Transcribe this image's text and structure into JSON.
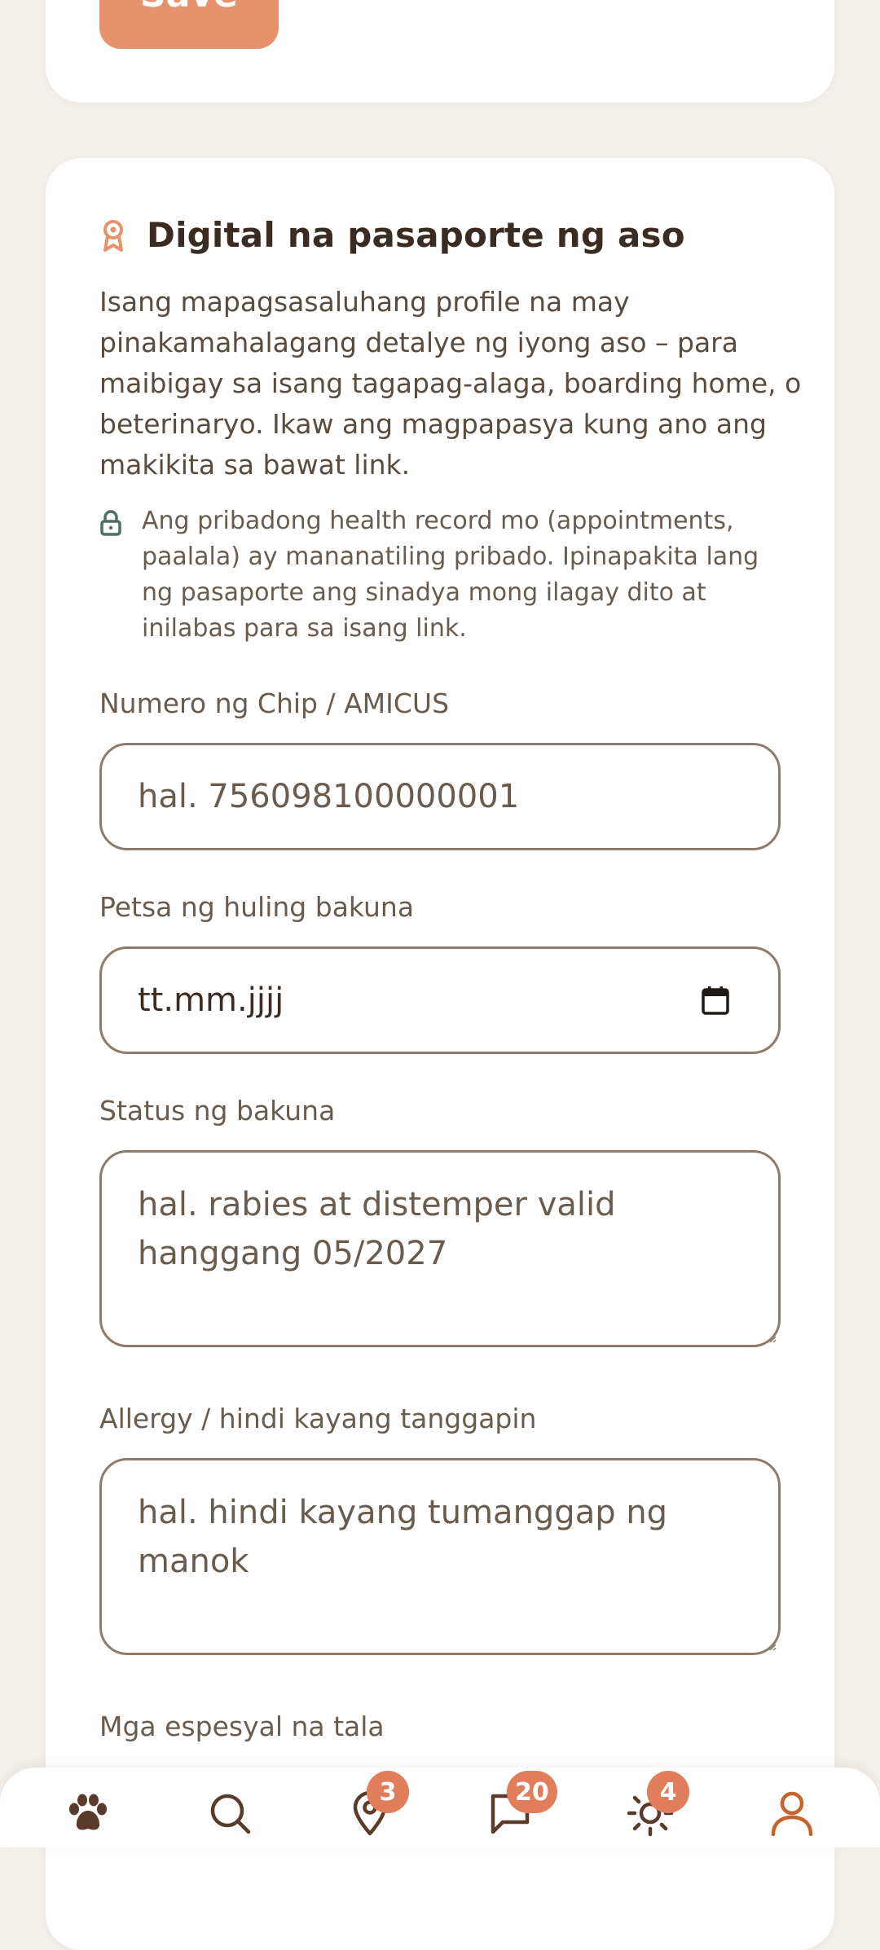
{
  "top_card": {
    "save_label": "Save"
  },
  "passport": {
    "title": "Digital na pasaporte ng aso",
    "title_icon": "badge-ribbon-icon",
    "description": "Isang mapagsasaluhang profile na may pinakamahalagang detalye ng iyong aso – para maibigay sa isang tagapag-alaga, boarding home, o beterinaryo. Ikaw ang magpapasya kung ano ang makikita sa bawat link.",
    "privacy_icon": "lock-icon",
    "privacy_note": "Ang pribadong health record mo (appointments, paalala) ay mananatiling pribado. Ipinapakita lang ng pasaporte ang sinadya mong ilagay dito at inilabas para sa isang link.",
    "fields": {
      "chip": {
        "label": "Numero ng Chip / AMICUS",
        "placeholder": "hal. 756098100000001"
      },
      "vaccine_date": {
        "label": "Petsa ng huling bakuna",
        "value": "tt.mm.jjjj",
        "icon": "calendar-icon"
      },
      "vaccine_status": {
        "label": "Status ng bakuna",
        "placeholder": "hal. rabies at distemper valid hanggang 05/2027"
      },
      "allergy": {
        "label": "Allergy / hindi kayang tanggapin",
        "placeholder": "hal. hindi kayang tumanggap ng manok"
      },
      "notes": {
        "label": "Mga espesyal na tala"
      }
    }
  },
  "nav": {
    "items": [
      {
        "icon": "paw-icon",
        "badge": ""
      },
      {
        "icon": "search-icon",
        "badge": ""
      },
      {
        "icon": "map-pin-icon",
        "badge": "3"
      },
      {
        "icon": "chat-icon",
        "badge": "20"
      },
      {
        "icon": "sun-icon",
        "badge": "4"
      },
      {
        "icon": "user-icon",
        "badge": ""
      }
    ]
  },
  "colors": {
    "accent": "#e6936d",
    "badge": "#e07e5c",
    "text": "#3a2c22",
    "muted": "#6a5b4f",
    "border": "#8d7b6d",
    "lock": "#4f6f66",
    "background": "#f3efeb"
  }
}
